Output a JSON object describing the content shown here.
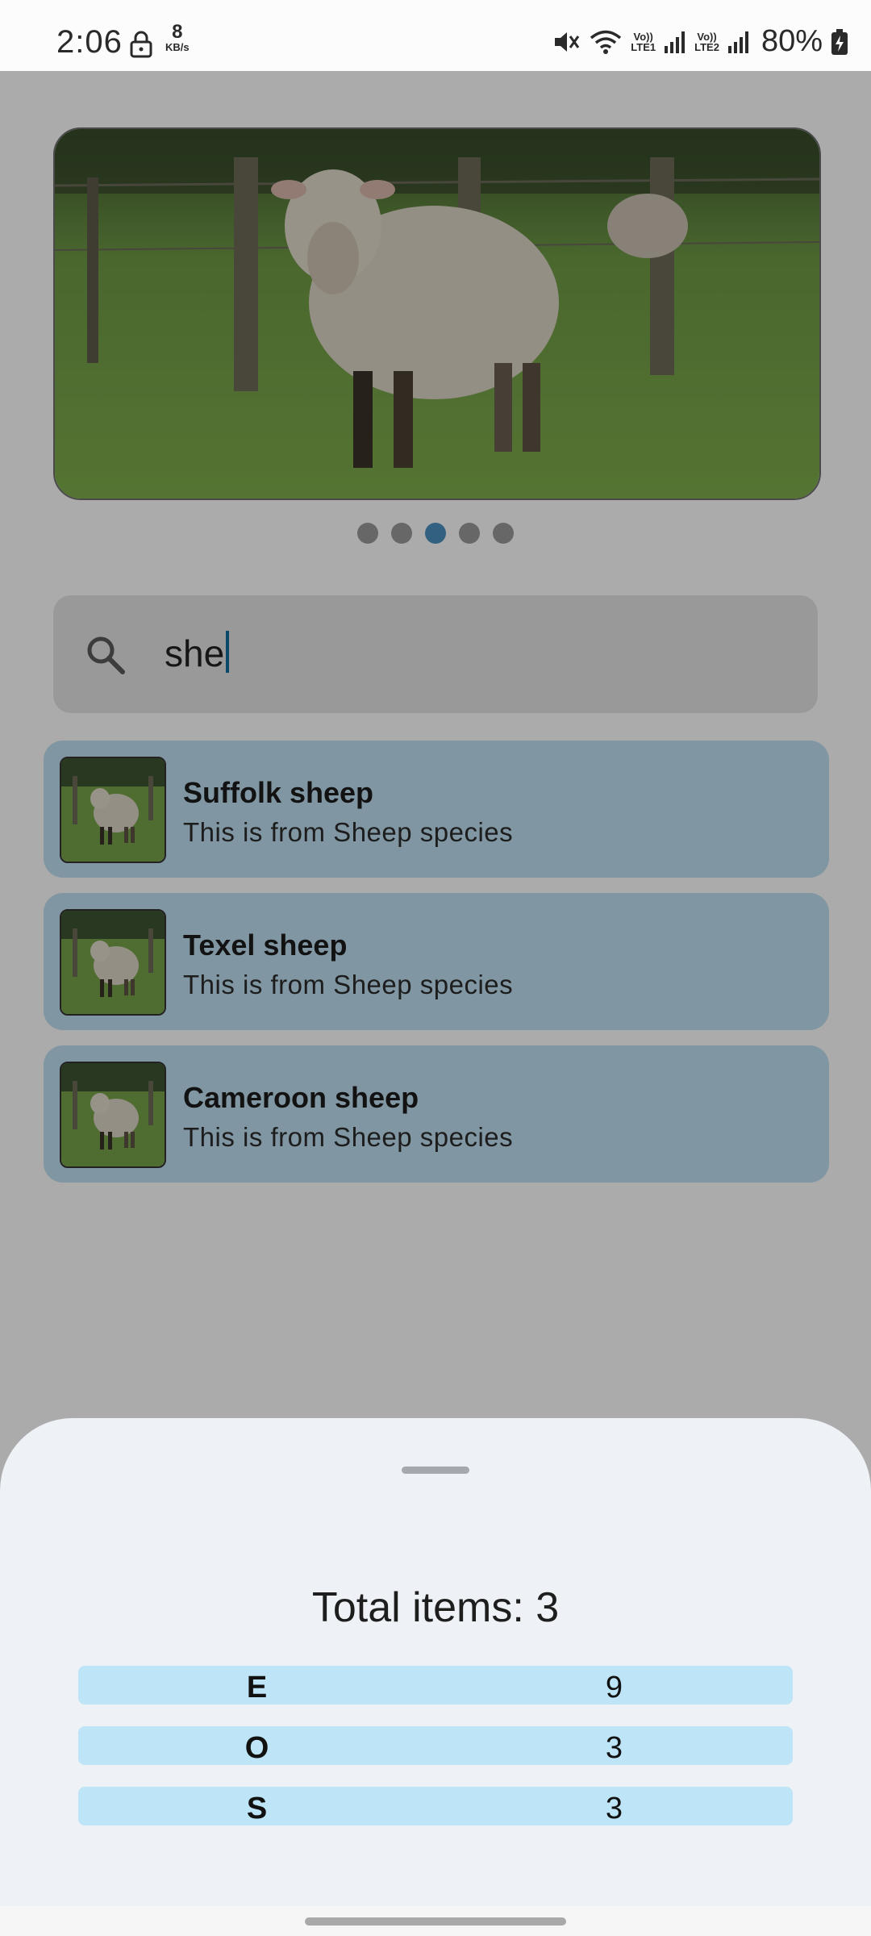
{
  "status_bar": {
    "time": "2:06",
    "speed_value": "8",
    "speed_unit": "KB/s",
    "lte1": "LTE1",
    "lte2": "LTE2",
    "volte": "Vo))",
    "battery": "80%",
    "icons": [
      "lock-icon",
      "mute-icon",
      "wifi-icon",
      "signal-icon",
      "signal-icon",
      "battery-charging-icon"
    ]
  },
  "carousel": {
    "page_count": 5,
    "active_index": 2
  },
  "search": {
    "value": "she",
    "icon": "search-icon"
  },
  "results": [
    {
      "title": "Suffolk sheep",
      "subtitle": "This is from Sheep species"
    },
    {
      "title": "Texel sheep",
      "subtitle": "This is from Sheep species"
    },
    {
      "title": "Cameroon sheep",
      "subtitle": "This is from Sheep species"
    }
  ],
  "sheet": {
    "total": "Total items: 3",
    "rows": [
      {
        "key": "E",
        "value": "9"
      },
      {
        "key": "O",
        "value": "3"
      },
      {
        "key": "S",
        "value": "3"
      }
    ]
  },
  "colors": {
    "list_item_bg": "#bfe0f2",
    "active_dot": "#4a90c0",
    "table_row_bg": "#bde4f7",
    "sheet_bg": "#eef2f6"
  }
}
